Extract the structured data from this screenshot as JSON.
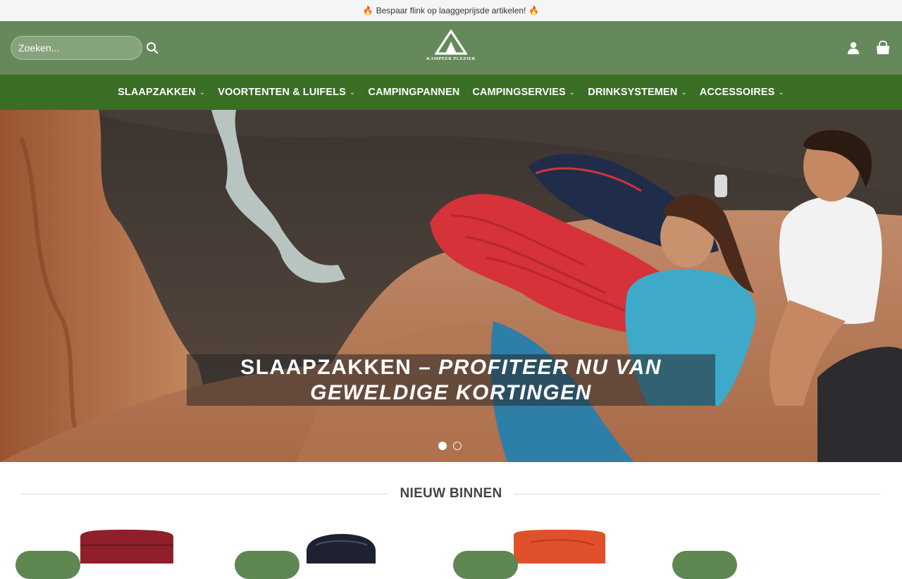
{
  "announcement": {
    "text": "Bespaar flink op laaggeprijsde artikelen!"
  },
  "header": {
    "search_placeholder": "Zoeken...",
    "logo_text": "KAMPEER PLEZIER"
  },
  "nav": {
    "items": [
      {
        "label": "SLAAPZAKKEN",
        "has_dropdown": true
      },
      {
        "label": "VOORTENTEN & LUIFELS",
        "has_dropdown": true
      },
      {
        "label": "CAMPINGPANNEN",
        "has_dropdown": false
      },
      {
        "label": "CAMPINGSERVIES",
        "has_dropdown": true
      },
      {
        "label": "DRINKSYSTEMEN",
        "has_dropdown": true
      },
      {
        "label": "ACCESSOIRES",
        "has_dropdown": true
      }
    ]
  },
  "hero": {
    "caption_line1_normal": "SLAAPZAKKEN – ",
    "caption_line1_italic": "PROFITEER NU VAN",
    "caption_line2_italic": "GEWELDIGE KORTINGEN",
    "slides": 2,
    "active_slide": 1
  },
  "section": {
    "title": "NIEUW BINNEN"
  },
  "colors": {
    "header_bg": "#65895a",
    "nav_bg": "#3a6e25",
    "badge": "#5e8752"
  }
}
